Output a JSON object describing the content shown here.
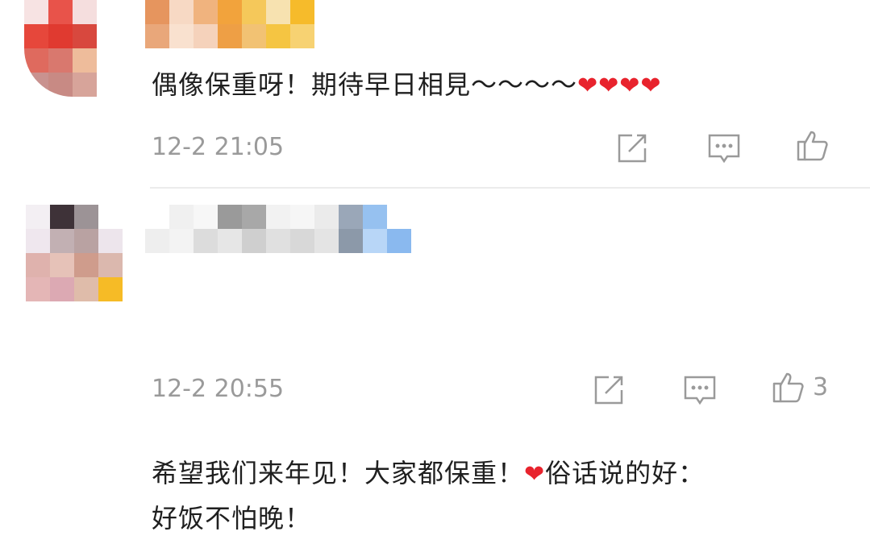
{
  "comments": [
    {
      "text_parts": [
        "偶像保重呀！期待早日相見～～～～"
      ],
      "hearts": "❤❤❤❤",
      "time": "12-2 21:05",
      "like_count": ""
    },
    {
      "line1_a": "希望我们来年见！大家都保重！",
      "line1_heart": "❤",
      "line1_b": "俗话说的好：",
      "line2": "好饭不怕晚！",
      "time": "12-2 20:55",
      "like_count": "3"
    }
  ],
  "icons": {
    "share": "share-icon",
    "comment": "comment-icon",
    "like": "thumbs-up-icon"
  },
  "colors": {
    "heart": "#e8232d",
    "meta_text": "#9a9a9a"
  }
}
